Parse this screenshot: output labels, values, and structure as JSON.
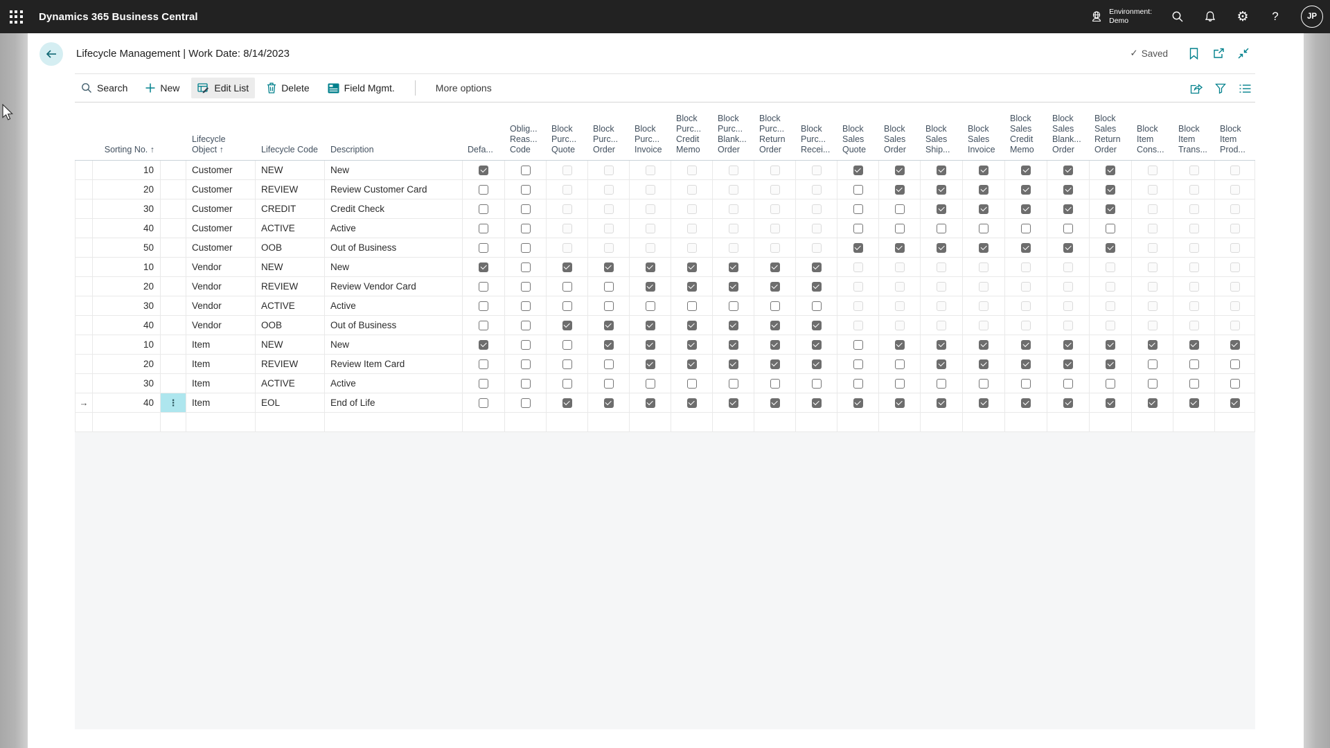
{
  "topbar": {
    "app_title": "Dynamics 365 Business Central",
    "environment_label": "Environment:",
    "environment_name": "Demo",
    "avatar_initials": "JP",
    "icons": [
      "waffle",
      "environment",
      "search",
      "notifications",
      "settings",
      "help",
      "avatar"
    ]
  },
  "page_header": {
    "title": "Lifecycle Management | Work Date: 8/14/2023",
    "saved_check": "✓",
    "saved_label": "Saved",
    "icons": [
      "bookmark",
      "open-in-new-window",
      "collapse"
    ]
  },
  "toolbar": {
    "search_label": "Search",
    "new_label": "New",
    "edit_list_label": "Edit List",
    "delete_label": "Delete",
    "field_mgmt_label": "Field Mgmt.",
    "more_options_label": "More options",
    "right_icons": [
      "share",
      "filter",
      "choose-columns"
    ]
  },
  "table": {
    "glyphs": {
      "selected_row_arrow": "→",
      "options_dots": "⋮"
    },
    "columns": [
      {
        "key": "row-gutter",
        "lines": [],
        "align": "left",
        "type": "gutter"
      },
      {
        "key": "sorting-no",
        "lines": [
          "Sorting No. ↑"
        ],
        "align": "right",
        "type": "number"
      },
      {
        "key": "row-options",
        "lines": [],
        "align": "left",
        "type": "options"
      },
      {
        "key": "lifecycle-object",
        "lines": [
          "Lifecycle",
          "Object ↑"
        ],
        "align": "left",
        "type": "text"
      },
      {
        "key": "lifecycle-code",
        "lines": [
          "Lifecycle Code"
        ],
        "align": "left",
        "type": "text"
      },
      {
        "key": "description",
        "lines": [
          "Description"
        ],
        "align": "left",
        "type": "text"
      },
      {
        "key": "default",
        "lines": [
          "Defa..."
        ],
        "align": "left",
        "type": "checkbox"
      },
      {
        "key": "oblig-reason-code",
        "lines": [
          "Oblig...",
          "Reas...",
          "Code"
        ],
        "align": "left",
        "type": "checkbox"
      },
      {
        "key": "block-purch-quote",
        "lines": [
          "Block",
          "Purc...",
          "Quote"
        ],
        "align": "left",
        "type": "checkbox"
      },
      {
        "key": "block-purch-order",
        "lines": [
          "Block",
          "Purc...",
          "Order"
        ],
        "align": "left",
        "type": "checkbox"
      },
      {
        "key": "block-purch-invoice",
        "lines": [
          "Block",
          "Purc...",
          "Invoice"
        ],
        "align": "left",
        "type": "checkbox"
      },
      {
        "key": "block-purch-credit-memo",
        "lines": [
          "Block",
          "Purc...",
          "Credit",
          "Memo"
        ],
        "align": "left",
        "type": "checkbox"
      },
      {
        "key": "block-purch-blanket-order",
        "lines": [
          "Block",
          "Purc...",
          "Blank...",
          "Order"
        ],
        "align": "left",
        "type": "checkbox"
      },
      {
        "key": "block-purch-return-order",
        "lines": [
          "Block",
          "Purc...",
          "Return",
          "Order"
        ],
        "align": "left",
        "type": "checkbox"
      },
      {
        "key": "block-purch-receipt",
        "lines": [
          "Block",
          "Purc...",
          "Recei..."
        ],
        "align": "left",
        "type": "checkbox"
      },
      {
        "key": "block-sales-quote",
        "lines": [
          "Block",
          "Sales",
          "Quote"
        ],
        "align": "left",
        "type": "checkbox"
      },
      {
        "key": "block-sales-order",
        "lines": [
          "Block",
          "Sales",
          "Order"
        ],
        "align": "left",
        "type": "checkbox"
      },
      {
        "key": "block-sales-shipment",
        "lines": [
          "Block",
          "Sales",
          "Ship..."
        ],
        "align": "left",
        "type": "checkbox"
      },
      {
        "key": "block-sales-invoice",
        "lines": [
          "Block",
          "Sales",
          "Invoice"
        ],
        "align": "left",
        "type": "checkbox"
      },
      {
        "key": "block-sales-credit-memo",
        "lines": [
          "Block",
          "Sales",
          "Credit",
          "Memo"
        ],
        "align": "left",
        "type": "checkbox"
      },
      {
        "key": "block-sales-blanket-order",
        "lines": [
          "Block",
          "Sales",
          "Blank...",
          "Order"
        ],
        "align": "left",
        "type": "checkbox"
      },
      {
        "key": "block-sales-return-order",
        "lines": [
          "Block",
          "Sales",
          "Return",
          "Order"
        ],
        "align": "left",
        "type": "checkbox"
      },
      {
        "key": "block-item-consumption",
        "lines": [
          "Block",
          "Item",
          "Cons..."
        ],
        "align": "left",
        "type": "checkbox"
      },
      {
        "key": "block-item-transfer",
        "lines": [
          "Block",
          "Item",
          "Trans..."
        ],
        "align": "left",
        "type": "checkbox"
      },
      {
        "key": "block-item-production",
        "lines": [
          "Block",
          "Item",
          "Prod..."
        ],
        "align": "left",
        "type": "checkbox"
      }
    ],
    "checkbox_state_legend": {
      "c": "checked",
      "u": "unchecked",
      "d": "disabled"
    },
    "rows": [
      {
        "sorting_no": "10",
        "object": "Customer",
        "code": "NEW",
        "description": "New",
        "states": "cudddddddcccccccddd",
        "selected": false
      },
      {
        "sorting_no": "20",
        "object": "Customer",
        "code": "REVIEW",
        "description": "Review Customer Card",
        "states": "uuddddddduccccccddd",
        "selected": false
      },
      {
        "sorting_no": "30",
        "object": "Customer",
        "code": "CREDIT",
        "description": "Credit Check",
        "states": "uuddddddduucccccddd",
        "selected": false
      },
      {
        "sorting_no": "40",
        "object": "Customer",
        "code": "ACTIVE",
        "description": "Active",
        "states": "uuddddddduuuuuuuddd",
        "selected": false
      },
      {
        "sorting_no": "50",
        "object": "Customer",
        "code": "OOB",
        "description": "Out of Business",
        "states": "uudddddddcccccccddd",
        "selected": false
      },
      {
        "sorting_no": "10",
        "object": "Vendor",
        "code": "NEW",
        "description": "New",
        "states": "cucccccccdddddddddd",
        "selected": false
      },
      {
        "sorting_no": "20",
        "object": "Vendor",
        "code": "REVIEW",
        "description": "Review Vendor Card",
        "states": "uuuucccccdddddddddd",
        "selected": false
      },
      {
        "sorting_no": "30",
        "object": "Vendor",
        "code": "ACTIVE",
        "description": "Active",
        "states": "uuuuuuuuudddddddddd",
        "selected": false
      },
      {
        "sorting_no": "40",
        "object": "Vendor",
        "code": "OOB",
        "description": "Out of Business",
        "states": "uucccccccdddddddddd",
        "selected": false
      },
      {
        "sorting_no": "10",
        "object": "Item",
        "code": "NEW",
        "description": "New",
        "states": "cuuccccccuccccccccc",
        "selected": false
      },
      {
        "sorting_no": "20",
        "object": "Item",
        "code": "REVIEW",
        "description": "Review Item Card",
        "states": "uuuucccccuucccccuuu",
        "selected": false
      },
      {
        "sorting_no": "30",
        "object": "Item",
        "code": "ACTIVE",
        "description": "Active",
        "states": "uuuuuuuuuuuuuuuuuuu",
        "selected": false
      },
      {
        "sorting_no": "40",
        "object": "Item",
        "code": "EOL",
        "description": "End of Life",
        "states": "uuccccccccccccccccc",
        "selected": true
      }
    ]
  },
  "colors": {
    "topbar_bg": "#222222",
    "accent_teal": "#00808c",
    "back_circle_bg": "#d5eef2",
    "selected_cell_bg": "#aee6ee",
    "checked_checkbox": "#6d6d6d",
    "empty_area_bg": "#f5f6f7",
    "header_text": "#42505f"
  }
}
